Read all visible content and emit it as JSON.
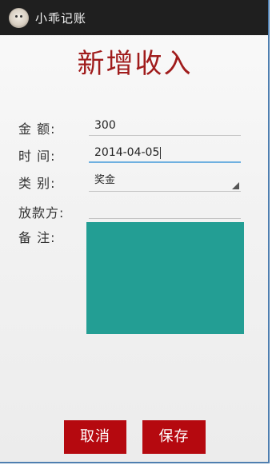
{
  "app": {
    "title": "小乖记账",
    "icon": "app-avatar-icon"
  },
  "page": {
    "title": "新增收入"
  },
  "form": {
    "amount": {
      "label": "金 额:",
      "value": "300"
    },
    "date": {
      "label": "时 间:",
      "value": "2014-04-05"
    },
    "category": {
      "label": "类 别:",
      "value": "奖金"
    },
    "payer": {
      "label": "放款方:",
      "value": ""
    },
    "note": {
      "label": "备 注:",
      "value": "",
      "color": "#239e94"
    }
  },
  "buttons": {
    "cancel_label": "取消",
    "save_label": "保存"
  },
  "colors": {
    "accent": "#b5090f",
    "title": "#a01c1c",
    "focus": "#6fb0e0",
    "titlebar": "#1f1f1f"
  }
}
